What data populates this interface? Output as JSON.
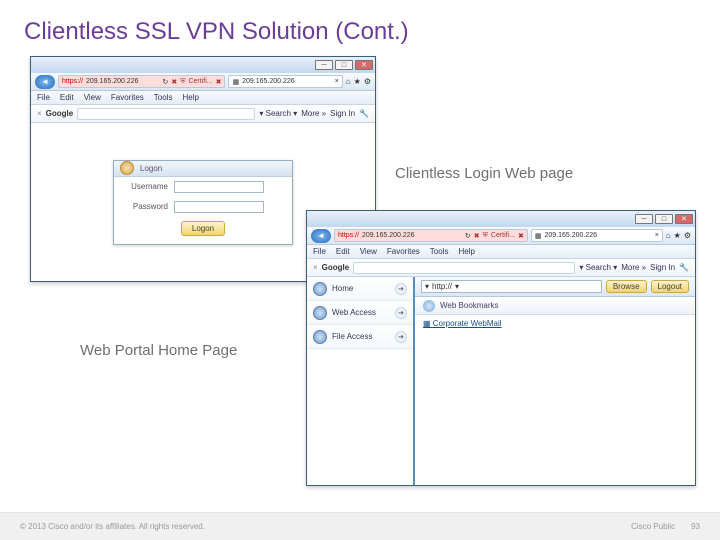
{
  "slide": {
    "title": "Clientless SSL VPN Solution (Cont.)",
    "caption_login": "Clientless Login Web page",
    "caption_portal": "Web Portal Home Page"
  },
  "footer": {
    "left": "© 2013 Cisco and/or its affiliates. All rights reserved.",
    "right": "Cisco Public",
    "page": "93"
  },
  "browser": {
    "ip": "209.165.200.226",
    "https_label": "https://",
    "cert_label": "Certifi...",
    "menus": [
      "File",
      "Edit",
      "View",
      "Favorites",
      "Tools",
      "Help"
    ],
    "google_label": "Google",
    "toolbar_search": "Search",
    "toolbar_more": "More »",
    "toolbar_signin": "Sign In",
    "scheme_selector": "http://"
  },
  "logon": {
    "title": "Logon",
    "username_label": "Username",
    "password_label": "Password",
    "button": "Logon"
  },
  "portal": {
    "browse_btn": "Browse",
    "logout_btn": "Logout",
    "left_items": [
      "Home",
      "Web Access",
      "File Access"
    ],
    "section": "Web Bookmarks",
    "bookmark": "Corporate WebMail"
  }
}
